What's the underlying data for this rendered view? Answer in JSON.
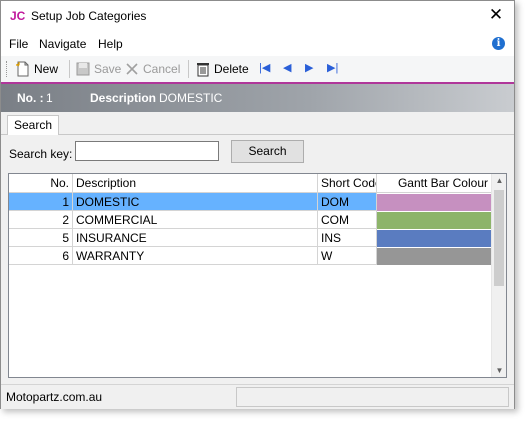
{
  "window": {
    "app_icon": "JC",
    "title": "Setup Job Categories"
  },
  "menu": {
    "file": "File",
    "navigate": "Navigate",
    "help": "Help"
  },
  "toolbar": {
    "new_label": "New",
    "save_label": "Save",
    "cancel_label": "Cancel",
    "delete_label": "Delete"
  },
  "header": {
    "no_label": "No. :",
    "no_value": "1",
    "description_label": "Description",
    "description_value": "DOMESTIC"
  },
  "tabs": [
    {
      "label": "Search"
    }
  ],
  "search": {
    "label": "Search key:",
    "value": "",
    "button_label": "Search"
  },
  "grid": {
    "columns": [
      "No.",
      "Description",
      "Short Code",
      "Gantt Bar Colour"
    ],
    "rows": [
      {
        "no": "1",
        "description": "DOMESTIC",
        "short_code": "DOM",
        "color": "#c690c0",
        "selected": true
      },
      {
        "no": "2",
        "description": "COMMERCIAL",
        "short_code": "COM",
        "color": "#8db46a",
        "selected": false
      },
      {
        "no": "5",
        "description": "INSURANCE",
        "short_code": "INS",
        "color": "#5a7cc0",
        "selected": false
      },
      {
        "no": "6",
        "description": "WARRANTY",
        "short_code": "W",
        "color": "#969696",
        "selected": false
      }
    ]
  },
  "status": {
    "text": "Motopartz.com.au"
  },
  "colors": {
    "accent": "#b0369a",
    "selection": "#66b2ff"
  }
}
